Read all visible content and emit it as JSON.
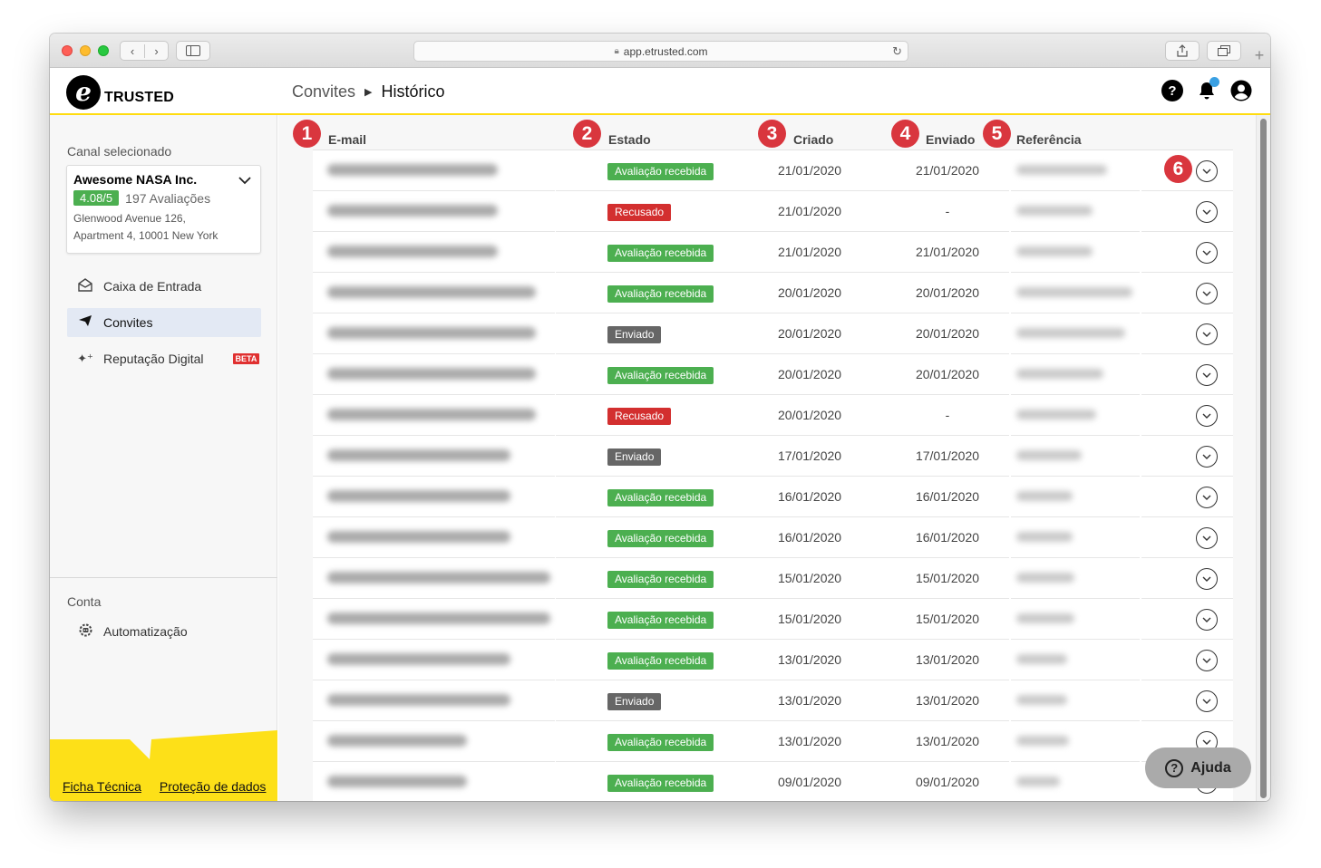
{
  "browser": {
    "url": "app.etrusted.com"
  },
  "header": {
    "logo_text": "TRUSTED",
    "logo_mark": "e",
    "breadcrumb": [
      "Convites",
      "Histórico"
    ]
  },
  "sidebar": {
    "channel_section_label": "Canal selecionado",
    "channel": {
      "name": "Awesome NASA Inc.",
      "rating": "4.08/5",
      "reviews": "197 Avaliações",
      "address_line1": "Glenwood Avenue 126,",
      "address_line2": "Apartment 4, 10001 New York"
    },
    "nav": [
      {
        "label": "Caixa de Entrada",
        "icon": "inbox-icon"
      },
      {
        "label": "Convites",
        "icon": "send-icon"
      },
      {
        "label": "Reputação Digital",
        "icon": "sparkle-icon",
        "badge": "BETA"
      }
    ],
    "account_label": "Conta",
    "account_nav": [
      {
        "label": "Automatização",
        "icon": "robot-gear-icon"
      }
    ],
    "footer_links": [
      "Ficha Técnica",
      "Proteção de dados"
    ]
  },
  "table": {
    "columns": [
      "E-mail",
      "Estado",
      "Criado",
      "Enviado",
      "Referência"
    ],
    "markers": [
      "1",
      "2",
      "3",
      "4",
      "5",
      "6"
    ],
    "rows": [
      {
        "status": "Avaliação recebida",
        "status_color": "green",
        "created": "21/01/2020",
        "sent": "21/01/2020"
      },
      {
        "status": "Recusado",
        "status_color": "red",
        "created": "21/01/2020",
        "sent": "-"
      },
      {
        "status": "Avaliação recebida",
        "status_color": "green",
        "created": "21/01/2020",
        "sent": "21/01/2020"
      },
      {
        "status": "Avaliação recebida",
        "status_color": "green",
        "created": "20/01/2020",
        "sent": "20/01/2020"
      },
      {
        "status": "Enviado",
        "status_color": "gray",
        "created": "20/01/2020",
        "sent": "20/01/2020"
      },
      {
        "status": "Avaliação recebida",
        "status_color": "green",
        "created": "20/01/2020",
        "sent": "20/01/2020"
      },
      {
        "status": "Recusado",
        "status_color": "red",
        "created": "20/01/2020",
        "sent": "-"
      },
      {
        "status": "Enviado",
        "status_color": "gray",
        "created": "17/01/2020",
        "sent": "17/01/2020"
      },
      {
        "status": "Avaliação recebida",
        "status_color": "green",
        "created": "16/01/2020",
        "sent": "16/01/2020"
      },
      {
        "status": "Avaliação recebida",
        "status_color": "green",
        "created": "16/01/2020",
        "sent": "16/01/2020"
      },
      {
        "status": "Avaliação recebida",
        "status_color": "green",
        "created": "15/01/2020",
        "sent": "15/01/2020"
      },
      {
        "status": "Avaliação recebida",
        "status_color": "green",
        "created": "15/01/2020",
        "sent": "15/01/2020"
      },
      {
        "status": "Avaliação recebida",
        "status_color": "green",
        "created": "13/01/2020",
        "sent": "13/01/2020"
      },
      {
        "status": "Enviado",
        "status_color": "gray",
        "created": "13/01/2020",
        "sent": "13/01/2020"
      },
      {
        "status": "Avaliação recebida",
        "status_color": "green",
        "created": "13/01/2020",
        "sent": "13/01/2020"
      },
      {
        "status": "Avaliação recebida",
        "status_color": "green",
        "created": "09/01/2020",
        "sent": "09/01/2020"
      }
    ]
  },
  "help_button": {
    "label": "Ajuda"
  },
  "colors": {
    "brand_yellow": "#ffdc0f",
    "status_green": "#4caf50",
    "status_red": "#d32f2f",
    "status_gray": "#666666",
    "marker_red": "#d9363e"
  }
}
